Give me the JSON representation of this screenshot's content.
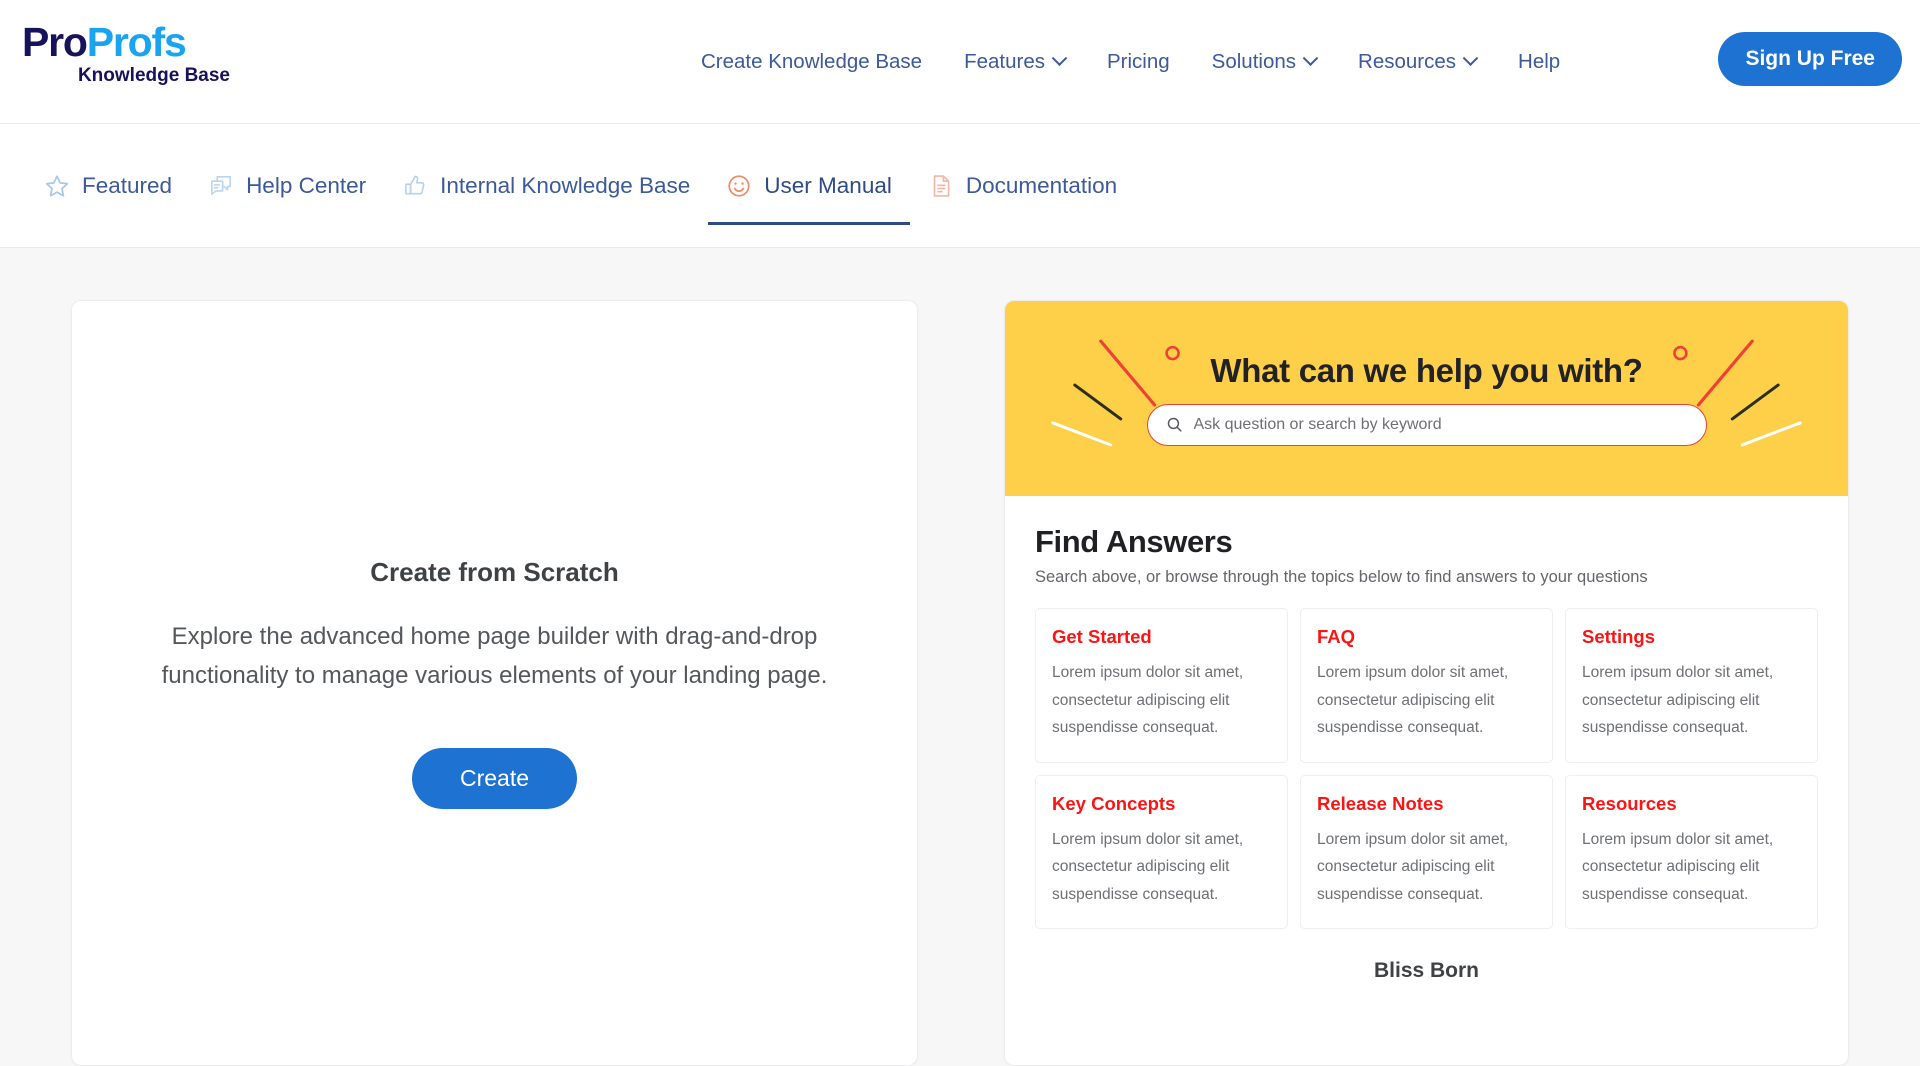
{
  "header": {
    "logo": {
      "part1": "Pro",
      "part2": "Profs",
      "subtitle": "Knowledge Base"
    },
    "nav_items": [
      {
        "label": "Create Knowledge Base",
        "has_caret": false
      },
      {
        "label": "Features",
        "has_caret": true
      },
      {
        "label": "Pricing",
        "has_caret": false
      },
      {
        "label": "Solutions",
        "has_caret": true
      },
      {
        "label": "Resources",
        "has_caret": true
      },
      {
        "label": "Help",
        "has_caret": false
      }
    ],
    "signup_label": "Sign Up Free"
  },
  "tabs": [
    {
      "label": "Featured",
      "icon": "star-icon",
      "active": false
    },
    {
      "label": "Help Center",
      "icon": "chat-bubbles-icon",
      "active": false
    },
    {
      "label": "Internal Knowledge Base",
      "icon": "thumbs-up-icon",
      "active": false
    },
    {
      "label": "User Manual",
      "icon": "smiley-face-icon",
      "active": true
    },
    {
      "label": "Documentation",
      "icon": "document-icon",
      "active": false
    }
  ],
  "left_panel": {
    "title": "Create from Scratch",
    "description": "Explore the advanced home page builder with drag-and-drop functionality to manage various elements of your landing page.",
    "button_label": "Create"
  },
  "preview": {
    "hero": {
      "title": "What can we help you with?",
      "search_placeholder": "Ask question or search by keyword",
      "search_value": "",
      "background_color": "#fed049",
      "border_color": "#ef4136"
    },
    "answers": {
      "title": "Find Answers",
      "subtitle": "Search above, or browse through the topics below to find answers to your questions",
      "topics": [
        {
          "title": "Get Started",
          "body": "Lorem ipsum dolor sit amet, consectetur adipiscing  elit suspendisse consequat."
        },
        {
          "title": "FAQ",
          "body": "Lorem ipsum dolor sit amet, consectetur adipiscing  elit suspendisse consequat."
        },
        {
          "title": "Settings",
          "body": "Lorem ipsum dolor sit amet, consectetur adipiscing  elit suspendisse consequat."
        },
        {
          "title": "Key Concepts",
          "body": "Lorem ipsum dolor sit amet, consectetur adipiscing  elit suspendisse consequat."
        },
        {
          "title": "Release Notes",
          "body": "Lorem ipsum dolor sit amet, consectetur adipiscing  elit suspendisse consequat."
        },
        {
          "title": "Resources",
          "body": "Lorem ipsum dolor sit amet, consectetur adipiscing  elit suspendisse consequat."
        }
      ],
      "topic_title_color": "#fb1414"
    },
    "footer_text": "Bliss Born"
  },
  "colors": {
    "brand_blue": "#1d72d2",
    "nav_blue": "#3c5a9a",
    "logo_navy": "#16125c",
    "logo_cyan": "#1aa3f0",
    "hero_yellow": "#fed049",
    "accent_red": "#ef4136"
  }
}
